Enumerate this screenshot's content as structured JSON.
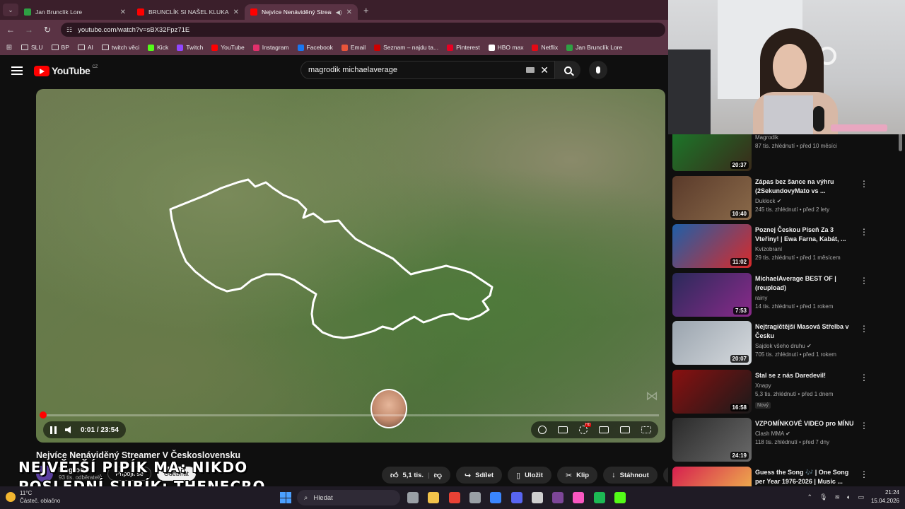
{
  "browser": {
    "tabs": [
      {
        "title": "Jan Brunclík Lore",
        "favicon_color": "#2ea043",
        "active": false
      },
      {
        "title": "BRUNCLÍK SI NAŠEL KLUKA! - Y",
        "favicon_color": "#ff0000",
        "active": false
      },
      {
        "title": "Nejvíce Nenáviděný Stream",
        "favicon_color": "#ff0000",
        "active": true
      }
    ],
    "new_tab_symbol": "+",
    "url": "youtube.com/watch?v=sBX32Fpz71E",
    "bookmarks": [
      {
        "label": "SLU",
        "icon": "folder-icon"
      },
      {
        "label": "BP",
        "icon": "folder-icon"
      },
      {
        "label": "AI",
        "icon": "folder-icon"
      },
      {
        "label": "twitch věci",
        "icon": "folder-icon"
      },
      {
        "label": "Kick",
        "icon": "kick-icon",
        "color": "#53fc18"
      },
      {
        "label": "Twitch",
        "icon": "twitch-icon",
        "color": "#9146ff"
      },
      {
        "label": "YouTube",
        "icon": "youtube-icon",
        "color": "#ff0000"
      },
      {
        "label": "Instagram",
        "icon": "instagram-icon",
        "color": "#e1306c"
      },
      {
        "label": "Facebook",
        "icon": "facebook-icon",
        "color": "#1877f2"
      },
      {
        "label": "Email",
        "icon": "email-icon",
        "color": "#e8553a"
      },
      {
        "label": "Seznam – najdu ta...",
        "icon": "seznam-icon",
        "color": "#cc0000"
      },
      {
        "label": "Pinterest",
        "icon": "pinterest-icon",
        "color": "#e60023"
      },
      {
        "label": "HBO max",
        "icon": "hbo-icon",
        "color": "#ffffff"
      },
      {
        "label": "Netflix",
        "icon": "netflix-icon",
        "color": "#e50914"
      },
      {
        "label": "Jan Brunclík Lore",
        "icon": "lore-icon",
        "color": "#2ea043"
      }
    ]
  },
  "youtube": {
    "logo_text": "YouTube",
    "region": "CZ",
    "search_query": "magrodik michaelaverage"
  },
  "player": {
    "time_current": "0:01",
    "time_total": "23:54",
    "time_display": "0:01 / 23:54",
    "progress_fraction": 0.001,
    "hd_badge": "HD"
  },
  "video": {
    "title": "Nejvíce Nenáviděný Streamer V Československu",
    "channel_name": "Magrodik",
    "channel_subs": "93 tis. odběratelů",
    "join_label": "Připojit se",
    "subscribe_label": "Odebírat",
    "overlay_line1": "NEJVĚTŠÍ PIPÍK MA: NIKDO",
    "overlay_line2": "POSLEDNÍ SUBÍK: THENECRO",
    "like_count": "5,1 tis.",
    "share_label": "Sdílet",
    "save_label": "Uložit",
    "clip_label": "Klip",
    "download_label": "Stáhnout"
  },
  "recommendations": [
    {
      "title": "Magrodik",
      "title_hidden": true,
      "channel": "Magrodik",
      "meta": "87 tis. zhlédnutí • před 10 měsíci",
      "duration": "20:37",
      "thumb": [
        "#1a7a2a",
        "#3a2a1a"
      ]
    },
    {
      "title": "Zápas bez šance na výhru (2SekundovyMato vs ...",
      "channel": "Duklock",
      "verified": true,
      "meta": "245 tis. zhlédnutí • před 2 lety",
      "duration": "10:40",
      "thumb": [
        "#5a3a2a",
        "#8a6a4a"
      ]
    },
    {
      "title": "Poznej Českou Píseň Za 3 Vteřiny! | Ewa Farna, Kabát, ...",
      "channel": "Kvízobraní",
      "meta": "29 tis. zhlédnutí • před 1 měsícem",
      "duration": "11:02",
      "thumb": [
        "#1e5fa8",
        "#d92a2a"
      ]
    },
    {
      "title": "MichaelAverage BEST OF | (reupload)",
      "channel": "rainy",
      "meta": "14 tis. zhlédnutí • před 1 rokem",
      "duration": "7:53",
      "thumb": [
        "#2a2a5a",
        "#8a2a8a"
      ]
    },
    {
      "title": "Nejtragičtější Masová Střelba v Česku",
      "channel": "Sajdok všeho druhu",
      "verified": true,
      "meta": "705 tis. zhlédnutí • před 1 rokem",
      "duration": "20:07",
      "thumb": [
        "#9aa4ae",
        "#d6dade"
      ]
    },
    {
      "title": "Stal se z nás Daredevil!",
      "channel": "Xnapy",
      "meta": "5,3 tis. zhlédnutí • před 1 dnem",
      "badge": "Nový",
      "duration": "16:58",
      "thumb": [
        "#8a1010",
        "#1a1a1a"
      ]
    },
    {
      "title": "VZPOMÍNKOVÉ VIDEO pro MÍNU",
      "channel": "Clash MMA",
      "verified": true,
      "meta": "118 tis. zhlédnutí • před 7 dny",
      "duration": "24:19",
      "thumb": [
        "#2a2a2a",
        "#6a6a6a"
      ]
    },
    {
      "title": "Guess the Song 🎶 | One Song per Year 1976-2026 | Music ...",
      "channel": "The Quiz Place",
      "meta": "630 tis. zhlédnutí • před 2 měsíci",
      "duration": "14:57",
      "thumb": [
        "#d61f4f",
        "#f2c94c"
      ]
    }
  ],
  "taskbar": {
    "temperature": "11°C",
    "weather_text": "Částeč. oblačno",
    "search_label": "Hledat",
    "time": "21:24",
    "date": "15.04.2026",
    "apps": [
      {
        "name": "task-view-icon",
        "color": "#9aa0a6"
      },
      {
        "name": "file-explorer-icon",
        "color": "#f2c34a"
      },
      {
        "name": "chrome-icon",
        "color": "#e94235"
      },
      {
        "name": "settings-icon",
        "color": "#9aa0a6"
      },
      {
        "name": "photos-icon",
        "color": "#3a86ff"
      },
      {
        "name": "discord-icon",
        "color": "#5865f2"
      },
      {
        "name": "obs-icon",
        "color": "#cfcfcf"
      },
      {
        "name": "tor-icon",
        "color": "#7d4698"
      },
      {
        "name": "itunes-icon",
        "color": "#fa57c1"
      },
      {
        "name": "spotify-icon",
        "color": "#1db954"
      },
      {
        "name": "kick-icon",
        "color": "#53fc18"
      }
    ]
  }
}
